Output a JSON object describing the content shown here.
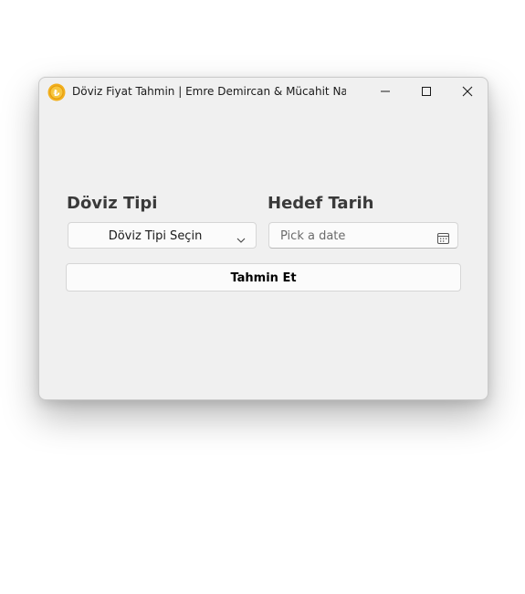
{
  "window": {
    "title": "Döviz Fiyat Tahmin | Emre Demircan & Mücahit Nas",
    "app_icon": "lira-coin-icon",
    "controls": {
      "minimize": "minimize-icon",
      "maximize": "maximize-icon",
      "close": "close-icon"
    }
  },
  "form": {
    "currency_label": "Döviz Tipi",
    "currency_select_value": "Döviz Tipi Seçin",
    "date_label": "Hedef Tarih",
    "date_placeholder": "Pick a date",
    "submit_label": "Tahmin Et"
  },
  "colors": {
    "window_bg": "#f0f0f0",
    "accent_icon": "#f2b01e",
    "label_text": "#3a3a3a"
  }
}
